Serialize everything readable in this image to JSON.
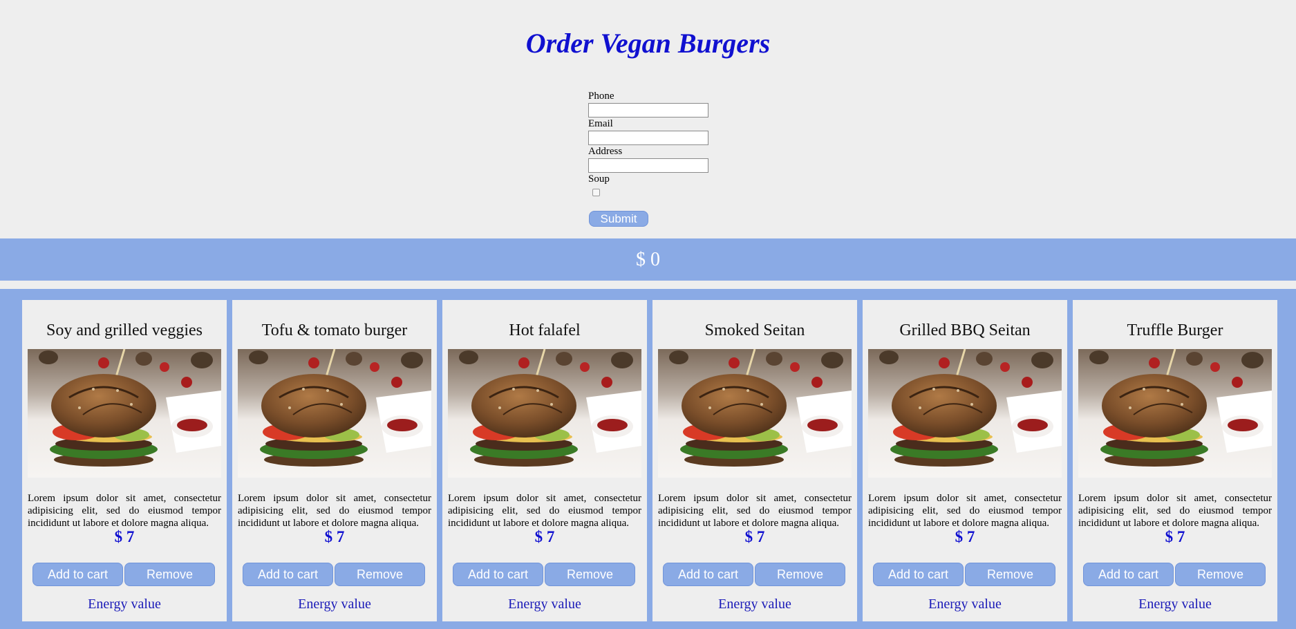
{
  "title": "Order Vegan Burgers",
  "form": {
    "phone_label": "Phone",
    "phone_value": "",
    "email_label": "Email",
    "email_value": "",
    "address_label": "Address",
    "address_value": "",
    "soup_label": "Soup",
    "soup_checked": false,
    "submit_label": "Submit"
  },
  "cart": {
    "total": "$ 0"
  },
  "colors": {
    "accent": "#8aaae5",
    "title": "#1010d0",
    "background": "#eeeeee"
  },
  "products": [
    {
      "name": "Soy and grilled veggies",
      "description": "Lorem ipsum dolor sit amet, consectetur adipisicing elit, sed do eiusmod tempor incididunt ut labore et dolore magna aliqua.",
      "price": "$ 7",
      "add_label": "Add to cart",
      "remove_label": "Remove",
      "energy_label": "Energy value"
    },
    {
      "name": "Tofu & tomato burger",
      "description": "Lorem ipsum dolor sit amet, consectetur adipisicing elit, sed do eiusmod tempor incididunt ut labore et dolore magna aliqua.",
      "price": "$ 7",
      "add_label": "Add to cart",
      "remove_label": "Remove",
      "energy_label": "Energy value"
    },
    {
      "name": "Hot falafel",
      "description": "Lorem ipsum dolor sit amet, consectetur adipisicing elit, sed do eiusmod tempor incididunt ut labore et dolore magna aliqua.",
      "price": "$ 7",
      "add_label": "Add to cart",
      "remove_label": "Remove",
      "energy_label": "Energy value"
    },
    {
      "name": "Smoked Seitan",
      "description": "Lorem ipsum dolor sit amet, consectetur adipisicing elit, sed do eiusmod tempor incididunt ut labore et dolore magna aliqua.",
      "price": "$ 7",
      "add_label": "Add to cart",
      "remove_label": "Remove",
      "energy_label": "Energy value"
    },
    {
      "name": "Grilled BBQ Seitan",
      "description": "Lorem ipsum dolor sit amet, consectetur adipisicing elit, sed do eiusmod tempor incididunt ut labore et dolore magna aliqua.",
      "price": "$ 7",
      "add_label": "Add to cart",
      "remove_label": "Remove",
      "energy_label": "Energy value"
    },
    {
      "name": "Truffle Burger",
      "description": "Lorem ipsum dolor sit amet, consectetur adipisicing elit, sed do eiusmod tempor incididunt ut labore et dolore magna aliqua.",
      "price": "$ 7",
      "add_label": "Add to cart",
      "remove_label": "Remove",
      "energy_label": "Energy value"
    }
  ]
}
